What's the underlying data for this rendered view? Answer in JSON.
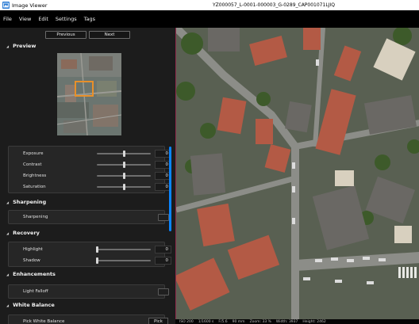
{
  "window": {
    "app_title": "Image Viewer",
    "file_title": "YZ000057_L-0001-000003_G-0289_CAP001071LJIQ",
    "app_icon": "image-viewer-icon"
  },
  "menu": {
    "items": [
      "File",
      "View",
      "Edit",
      "Settings",
      "Tags"
    ]
  },
  "nav": {
    "previous_label": "Previous",
    "next_label": "Next"
  },
  "sections": {
    "preview": "Preview",
    "sharpening": "Sharpening",
    "recovery": "Recovery",
    "enhancements": "Enhancements",
    "white_balance": "White Balance"
  },
  "adjustments": {
    "exposure": {
      "label": "Exposure",
      "value": "0",
      "level": 0.5
    },
    "contrast": {
      "label": "Contrast",
      "value": "0",
      "level": 0.5
    },
    "brightness": {
      "label": "Brightness",
      "value": "0",
      "level": 0.5
    },
    "saturation": {
      "label": "Saturation",
      "value": "0",
      "level": 0.5
    }
  },
  "sharpening": {
    "label": "Sharpening",
    "enabled": false
  },
  "recovery": {
    "highlight": {
      "label": "Highlight",
      "value": "0",
      "level": 0.0
    },
    "shadow": {
      "label": "Shadow",
      "value": "0",
      "level": 0.0
    }
  },
  "enhancements": {
    "light_falloff": {
      "label": "Light Falloff",
      "enabled": false
    }
  },
  "white_balance": {
    "pick_label": "Pick White Balance",
    "pick_button": "Pick"
  },
  "status": {
    "iso": "ISO 200",
    "shutter": "1/1600 s",
    "aperture": "F/5.6",
    "focal": "90 mm",
    "zoom": "Zoom: 33 %",
    "width": "Width: 3937",
    "height": "Height: 2462"
  },
  "colors": {
    "accent_scrollbar": "#0a84ff",
    "preview_highlight": "#e8902a",
    "viewer_border": "#8e2a4a"
  }
}
